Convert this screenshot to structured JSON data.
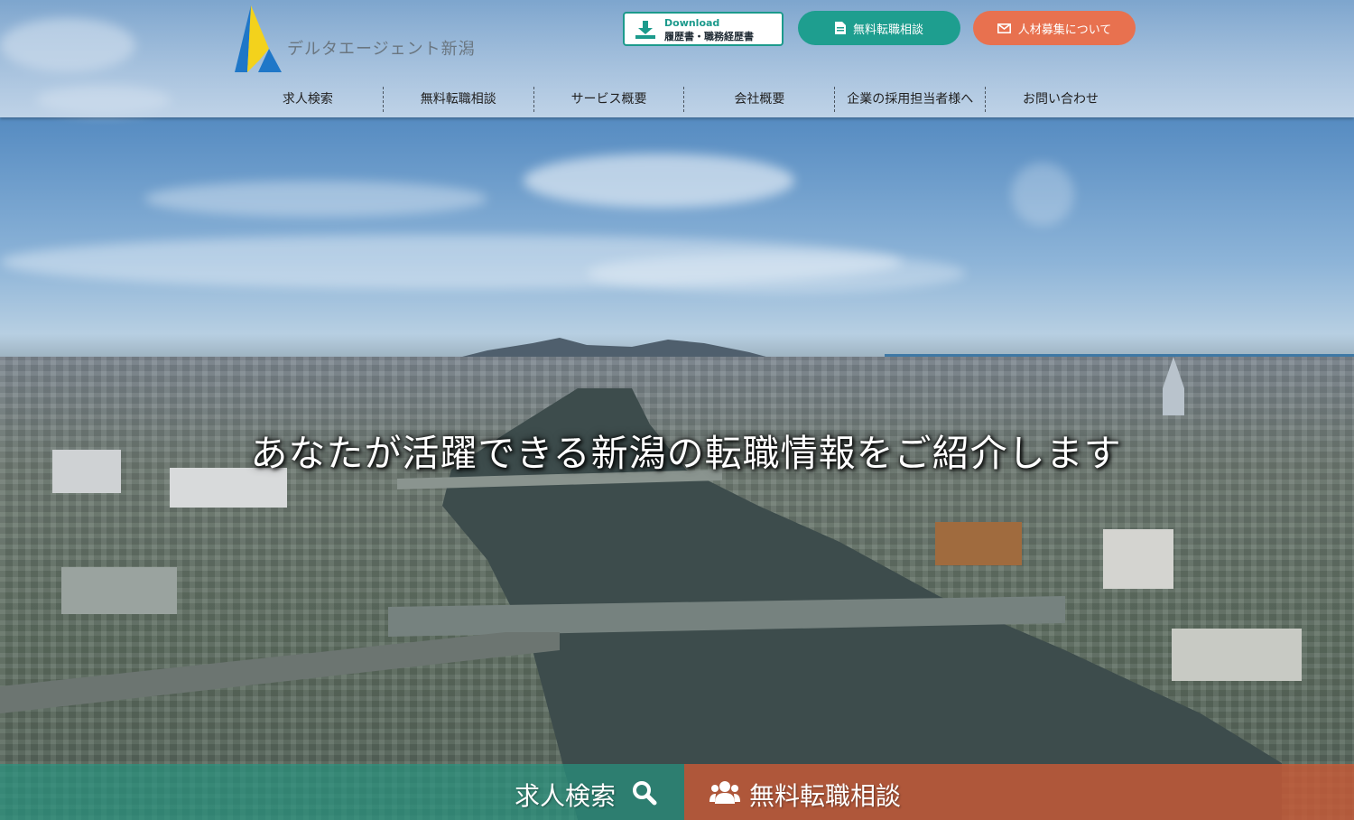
{
  "brand": {
    "name": "デルタエージェント新潟"
  },
  "header": {
    "download": {
      "small": "Download",
      "main": "履歴書・職務経歴書",
      "icon": "download-icon"
    },
    "consult_button": {
      "label": "無料転職相談",
      "icon": "document-icon"
    },
    "recruit_button": {
      "label": "人材募集について",
      "icon": "mail-icon"
    }
  },
  "nav": {
    "items": [
      {
        "label": "求人検索"
      },
      {
        "label": "無料転職相談"
      },
      {
        "label": "サービス概要"
      },
      {
        "label": "会社概要"
      },
      {
        "label": "企業の採用担当者様へ"
      },
      {
        "label": "お問い合わせ"
      }
    ]
  },
  "hero": {
    "headline": "あなたが活躍できる新潟の転職情報をご紹介します"
  },
  "cta": {
    "search": {
      "label": "求人検索",
      "icon": "search-icon"
    },
    "consult": {
      "label": "無料転職相談",
      "icon": "users-icon"
    }
  },
  "colors": {
    "teal": "#1e9e8f",
    "orange": "#e8714f",
    "logo_blue": "#1f77c8",
    "logo_yellow": "#f3d21c"
  }
}
